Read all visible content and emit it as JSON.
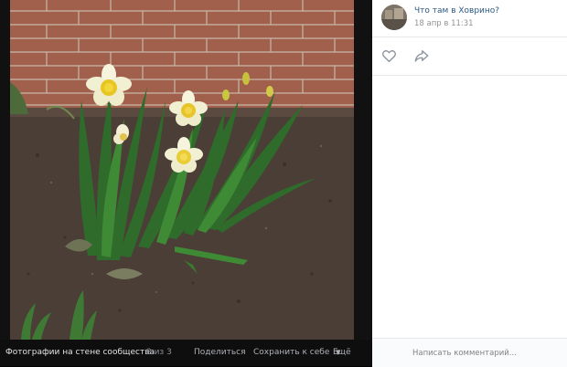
{
  "viewer": {
    "album_title": "Фотографии на стене сообщества",
    "counter": "2 из 3",
    "actions": {
      "share": "Поделиться",
      "save": "Сохранить к себе",
      "more": "Ещё"
    }
  },
  "post": {
    "group_name": "Что там в Ховрино?",
    "date": "18 апр в 11:31"
  },
  "comment": {
    "placeholder": "Написать комментарий..."
  },
  "colors": {
    "link": "#2a5885",
    "muted": "#939393",
    "icon": "#8a929c",
    "viewer_bg": "#111111"
  },
  "icons": {
    "like": "heart-icon",
    "share": "share-arrow-icon",
    "more": "chevron-down-icon"
  }
}
